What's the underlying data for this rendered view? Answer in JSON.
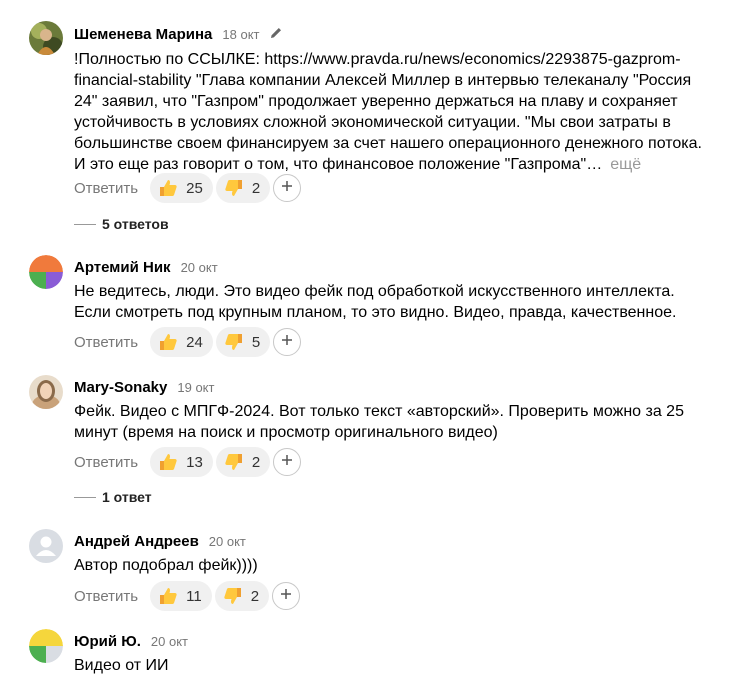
{
  "reply_label": "Ответить",
  "comments": [
    {
      "author": "Шеменева Марина",
      "date": "18 окт",
      "text": "!Полностью по ССЫЛКЕ: https://www.pravda.ru/news/economics/2293875-gazprom-financial-stability \"Глава компании Алексей Миллер в интервью телеканалу \"Россия 24\" заявил, что \"Газпром\" продолжает уверенно держаться на плаву и сохраняет устойчивость в условиях сложной экономической ситуации. \"Мы свои затраты в большинстве своем финансируем за счет нашего операционного денежного потока. И это еще раз говорит о том, что финансовое положение \"Газпрома\"…",
      "more": "ещё",
      "likes": "25",
      "dislikes": "2",
      "replies": "5 ответов"
    },
    {
      "author": "Артемий Ник",
      "date": "20 окт",
      "text": "Не ведитесь, люди. Это видео фейк под обработкой искусственного интеллекта. Если смотреть под крупным планом, то это видно. Видео, правда, качественное.",
      "likes": "24",
      "dislikes": "5"
    },
    {
      "author": "Mary-Sonaky",
      "date": "19 окт",
      "text": "Фейк. Видео с МПГФ-2024. Вот только текст «авторский». Проверить можно за 25 минут (время на поиск и просмотр оригинального видео)",
      "likes": "13",
      "dislikes": "2",
      "replies": "1 ответ"
    },
    {
      "author": "Андрей Андреев",
      "date": "20 окт",
      "text": "Автор подобрал фейк))))",
      "likes": "11",
      "dislikes": "2"
    },
    {
      "author": "Юрий Ю.",
      "date": "20 окт",
      "text": "Видео от ИИ"
    }
  ]
}
